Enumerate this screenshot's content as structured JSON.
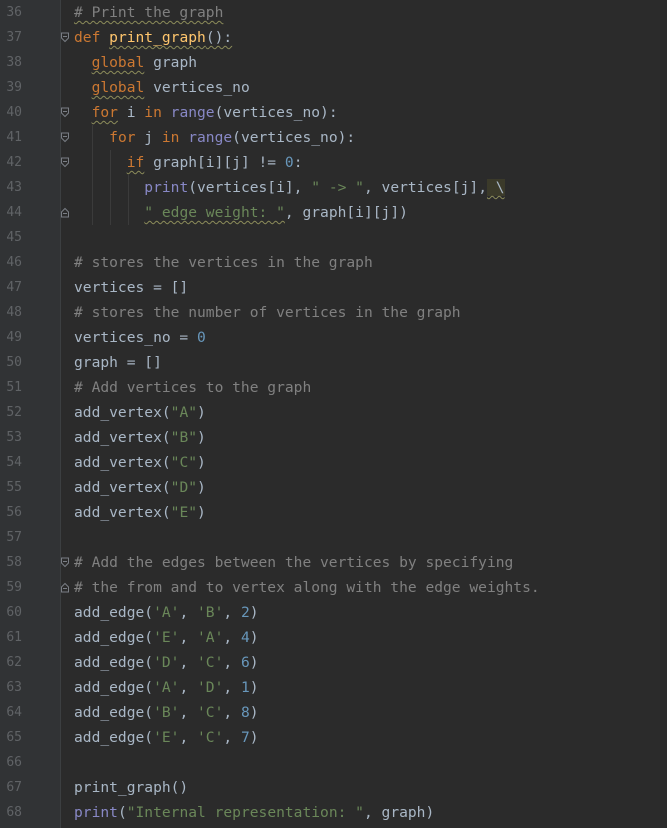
{
  "editor": {
    "language": "python",
    "colors": {
      "background": "#2b2b2b",
      "gutter": "#313335",
      "keyword": "#cc7832",
      "function": "#ffc66d",
      "string": "#6a8759",
      "number": "#6897bb",
      "comment": "#808080",
      "builtin": "#8888c6",
      "text": "#a9b7c6"
    },
    "lines": [
      {
        "num": "36",
        "fold": "",
        "tokens": [
          {
            "t": "# Print the graph",
            "c": "cm",
            "w": true
          }
        ]
      },
      {
        "num": "37",
        "fold": "open",
        "tokens": [
          {
            "t": "def ",
            "c": "kw"
          },
          {
            "t": "print_graph",
            "c": "fn",
            "w": true
          },
          {
            "t": "():",
            "c": "plain",
            "w": true
          }
        ]
      },
      {
        "num": "38",
        "fold": "",
        "tokens": [
          {
            "t": "  ",
            "c": "plain"
          },
          {
            "t": "global",
            "c": "kw",
            "w": true
          },
          {
            "t": " graph",
            "c": "plain"
          }
        ]
      },
      {
        "num": "39",
        "fold": "",
        "tokens": [
          {
            "t": "  ",
            "c": "plain"
          },
          {
            "t": "global",
            "c": "kw",
            "w": true
          },
          {
            "t": " vertices_no",
            "c": "plain"
          }
        ]
      },
      {
        "num": "40",
        "fold": "open",
        "tokens": [
          {
            "t": "  ",
            "c": "plain"
          },
          {
            "t": "for",
            "c": "kw",
            "w": true
          },
          {
            "t": " i ",
            "c": "plain"
          },
          {
            "t": "in ",
            "c": "kw"
          },
          {
            "t": "range",
            "c": "bi"
          },
          {
            "t": "(vertices_no):",
            "c": "plain"
          }
        ]
      },
      {
        "num": "41",
        "fold": "open",
        "tokens": [
          {
            "t": "    ",
            "c": "plain"
          },
          {
            "t": "for",
            "c": "kw"
          },
          {
            "t": " j ",
            "c": "plain"
          },
          {
            "t": "in ",
            "c": "kw"
          },
          {
            "t": "range",
            "c": "bi"
          },
          {
            "t": "(vertices_no):",
            "c": "plain"
          }
        ]
      },
      {
        "num": "42",
        "fold": "open",
        "tokens": [
          {
            "t": "      ",
            "c": "plain"
          },
          {
            "t": "if",
            "c": "kw",
            "w": true
          },
          {
            "t": " graph[i][j] != ",
            "c": "plain"
          },
          {
            "t": "0",
            "c": "num"
          },
          {
            "t": ":",
            "c": "plain"
          }
        ]
      },
      {
        "num": "43",
        "fold": "",
        "tokens": [
          {
            "t": "        ",
            "c": "plain"
          },
          {
            "t": "print",
            "c": "bi"
          },
          {
            "t": "(vertices[i], ",
            "c": "plain"
          },
          {
            "t": "\" -> \"",
            "c": "str"
          },
          {
            "t": ", vertices[j],",
            "c": "plain"
          },
          {
            "t": " \\",
            "c": "hl",
            "w": true
          }
        ]
      },
      {
        "num": "44",
        "fold": "close",
        "tokens": [
          {
            "t": "        ",
            "c": "plain"
          },
          {
            "t": "\" edge weight: \"",
            "c": "str",
            "w": true
          },
          {
            "t": ", graph[i][j])",
            "c": "plain"
          }
        ]
      },
      {
        "num": "45",
        "fold": "",
        "tokens": []
      },
      {
        "num": "46",
        "fold": "",
        "tokens": [
          {
            "t": "# stores the vertices in the graph",
            "c": "cm"
          }
        ]
      },
      {
        "num": "47",
        "fold": "",
        "tokens": [
          {
            "t": "vertices = []",
            "c": "plain"
          }
        ]
      },
      {
        "num": "48",
        "fold": "",
        "tokens": [
          {
            "t": "# stores the number of vertices in the graph",
            "c": "cm"
          }
        ]
      },
      {
        "num": "49",
        "fold": "",
        "tokens": [
          {
            "t": "vertices_no = ",
            "c": "plain"
          },
          {
            "t": "0",
            "c": "num"
          }
        ]
      },
      {
        "num": "50",
        "fold": "",
        "tokens": [
          {
            "t": "graph = []",
            "c": "plain"
          }
        ]
      },
      {
        "num": "51",
        "fold": "",
        "tokens": [
          {
            "t": "# Add vertices to the graph",
            "c": "cm"
          }
        ]
      },
      {
        "num": "52",
        "fold": "",
        "tokens": [
          {
            "t": "add_vertex(",
            "c": "plain"
          },
          {
            "t": "\"A\"",
            "c": "str"
          },
          {
            "t": ")",
            "c": "plain"
          }
        ]
      },
      {
        "num": "53",
        "fold": "",
        "tokens": [
          {
            "t": "add_vertex(",
            "c": "plain"
          },
          {
            "t": "\"B\"",
            "c": "str"
          },
          {
            "t": ")",
            "c": "plain"
          }
        ]
      },
      {
        "num": "54",
        "fold": "",
        "tokens": [
          {
            "t": "add_vertex(",
            "c": "plain"
          },
          {
            "t": "\"C\"",
            "c": "str"
          },
          {
            "t": ")",
            "c": "plain"
          }
        ]
      },
      {
        "num": "55",
        "fold": "",
        "tokens": [
          {
            "t": "add_vertex(",
            "c": "plain"
          },
          {
            "t": "\"D\"",
            "c": "str"
          },
          {
            "t": ")",
            "c": "plain"
          }
        ]
      },
      {
        "num": "56",
        "fold": "",
        "tokens": [
          {
            "t": "add_vertex(",
            "c": "plain"
          },
          {
            "t": "\"E\"",
            "c": "str"
          },
          {
            "t": ")",
            "c": "plain"
          }
        ]
      },
      {
        "num": "57",
        "fold": "",
        "tokens": []
      },
      {
        "num": "58",
        "fold": "open",
        "tokens": [
          {
            "t": "# Add the edges between the vertices by specifying",
            "c": "cm"
          }
        ]
      },
      {
        "num": "59",
        "fold": "close",
        "tokens": [
          {
            "t": "# the from and to vertex along with the edge weights.",
            "c": "cm"
          }
        ]
      },
      {
        "num": "60",
        "fold": "",
        "tokens": [
          {
            "t": "add_edge(",
            "c": "plain"
          },
          {
            "t": "'A'",
            "c": "str"
          },
          {
            "t": ", ",
            "c": "plain"
          },
          {
            "t": "'B'",
            "c": "str"
          },
          {
            "t": ", ",
            "c": "plain"
          },
          {
            "t": "2",
            "c": "num"
          },
          {
            "t": ")",
            "c": "plain"
          }
        ]
      },
      {
        "num": "61",
        "fold": "",
        "tokens": [
          {
            "t": "add_edge(",
            "c": "plain"
          },
          {
            "t": "'E'",
            "c": "str"
          },
          {
            "t": ", ",
            "c": "plain"
          },
          {
            "t": "'A'",
            "c": "str"
          },
          {
            "t": ", ",
            "c": "plain"
          },
          {
            "t": "4",
            "c": "num"
          },
          {
            "t": ")",
            "c": "plain"
          }
        ]
      },
      {
        "num": "62",
        "fold": "",
        "tokens": [
          {
            "t": "add_edge(",
            "c": "plain"
          },
          {
            "t": "'D'",
            "c": "str"
          },
          {
            "t": ", ",
            "c": "plain"
          },
          {
            "t": "'C'",
            "c": "str"
          },
          {
            "t": ", ",
            "c": "plain"
          },
          {
            "t": "6",
            "c": "num"
          },
          {
            "t": ")",
            "c": "plain"
          }
        ]
      },
      {
        "num": "63",
        "fold": "",
        "tokens": [
          {
            "t": "add_edge(",
            "c": "plain"
          },
          {
            "t": "'A'",
            "c": "str"
          },
          {
            "t": ", ",
            "c": "plain"
          },
          {
            "t": "'D'",
            "c": "str"
          },
          {
            "t": ", ",
            "c": "plain"
          },
          {
            "t": "1",
            "c": "num"
          },
          {
            "t": ")",
            "c": "plain"
          }
        ]
      },
      {
        "num": "64",
        "fold": "",
        "tokens": [
          {
            "t": "add_edge(",
            "c": "plain"
          },
          {
            "t": "'B'",
            "c": "str"
          },
          {
            "t": ", ",
            "c": "plain"
          },
          {
            "t": "'C'",
            "c": "str"
          },
          {
            "t": ", ",
            "c": "plain"
          },
          {
            "t": "8",
            "c": "num"
          },
          {
            "t": ")",
            "c": "plain"
          }
        ]
      },
      {
        "num": "65",
        "fold": "",
        "tokens": [
          {
            "t": "add_edge(",
            "c": "plain"
          },
          {
            "t": "'E'",
            "c": "str"
          },
          {
            "t": ", ",
            "c": "plain"
          },
          {
            "t": "'C'",
            "c": "str"
          },
          {
            "t": ", ",
            "c": "plain"
          },
          {
            "t": "7",
            "c": "num"
          },
          {
            "t": ")",
            "c": "plain"
          }
        ]
      },
      {
        "num": "66",
        "fold": "",
        "tokens": []
      },
      {
        "num": "67",
        "fold": "",
        "tokens": [
          {
            "t": "print_graph()",
            "c": "plain"
          }
        ]
      },
      {
        "num": "68",
        "fold": "",
        "tokens": [
          {
            "t": "print",
            "c": "bi"
          },
          {
            "t": "(",
            "c": "plain"
          },
          {
            "t": "\"Internal representation: \"",
            "c": "str"
          },
          {
            "t": ", graph)",
            "c": "plain"
          }
        ]
      }
    ]
  }
}
